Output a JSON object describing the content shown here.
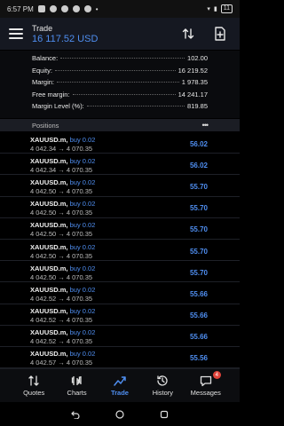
{
  "status": {
    "time": "6:57 PM",
    "battery": "11"
  },
  "header": {
    "title": "Trade",
    "balance": "16 117.52 USD"
  },
  "summary": [
    {
      "label": "Balance:",
      "value": "102.00"
    },
    {
      "label": "Equity:",
      "value": "16 219.52"
    },
    {
      "label": "Margin:",
      "value": "1 978.35"
    },
    {
      "label": "Free margin:",
      "value": "14 241.17"
    },
    {
      "label": "Margin Level (%):",
      "value": "819.85"
    }
  ],
  "positions": {
    "title": "Positions",
    "items": [
      {
        "symbol": "XAUUSD.m,",
        "action": "buy 0.02",
        "open": "4 042.34",
        "current": "4 070.35",
        "profit": "56.02"
      },
      {
        "symbol": "XAUUSD.m,",
        "action": "buy 0.02",
        "open": "4 042.34",
        "current": "4 070.35",
        "profit": "56.02"
      },
      {
        "symbol": "XAUUSD.m,",
        "action": "buy 0.02",
        "open": "4 042.50",
        "current": "4 070.35",
        "profit": "55.70"
      },
      {
        "symbol": "XAUUSD.m,",
        "action": "buy 0.02",
        "open": "4 042.50",
        "current": "4 070.35",
        "profit": "55.70"
      },
      {
        "symbol": "XAUUSD.m,",
        "action": "buy 0.02",
        "open": "4 042.50",
        "current": "4 070.35",
        "profit": "55.70"
      },
      {
        "symbol": "XAUUSD.m,",
        "action": "buy 0.02",
        "open": "4 042.50",
        "current": "4 070.35",
        "profit": "55.70"
      },
      {
        "symbol": "XAUUSD.m,",
        "action": "buy 0.02",
        "open": "4 042.50",
        "current": "4 070.35",
        "profit": "55.70"
      },
      {
        "symbol": "XAUUSD.m,",
        "action": "buy 0.02",
        "open": "4 042.52",
        "current": "4 070.35",
        "profit": "55.66"
      },
      {
        "symbol": "XAUUSD.m,",
        "action": "buy 0.02",
        "open": "4 042.52",
        "current": "4 070.35",
        "profit": "55.66"
      },
      {
        "symbol": "XAUUSD.m,",
        "action": "buy 0.02",
        "open": "4 042.52",
        "current": "4 070.35",
        "profit": "55.66"
      },
      {
        "symbol": "XAUUSD.m,",
        "action": "buy 0.02",
        "open": "4 042.57",
        "current": "4 070.35",
        "profit": "55.56"
      }
    ]
  },
  "tabs": [
    {
      "label": "Quotes",
      "icon": "quotes-icon"
    },
    {
      "label": "Charts",
      "icon": "charts-icon"
    },
    {
      "label": "Trade",
      "icon": "trade-icon",
      "active": true
    },
    {
      "label": "History",
      "icon": "history-icon"
    },
    {
      "label": "Messages",
      "icon": "messages-icon",
      "badge": "4"
    }
  ],
  "colors": {
    "accent": "#4f8ef0",
    "badge": "#e0433a",
    "header_bg": "#151821"
  }
}
